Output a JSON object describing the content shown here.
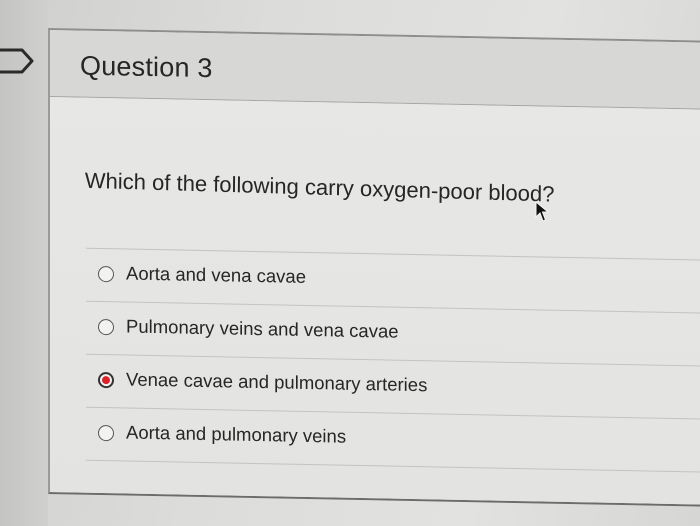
{
  "question": {
    "title": "Question 3",
    "text": "Which of the following carry oxygen-poor blood?"
  },
  "answers": [
    {
      "label": "Aorta and vena cavae",
      "selected": false
    },
    {
      "label": "Pulmonary veins and vena cavae",
      "selected": false
    },
    {
      "label": "Venae cavae and pulmonary arteries",
      "selected": true
    },
    {
      "label": "Aorta and pulmonary veins",
      "selected": false
    }
  ],
  "colors": {
    "selected_radio": "#d8232a",
    "text": "#262626",
    "card_background": "#e6e6e4"
  },
  "icons": {
    "flag": "flag-icon",
    "cursor": "mouse-pointer-icon"
  }
}
